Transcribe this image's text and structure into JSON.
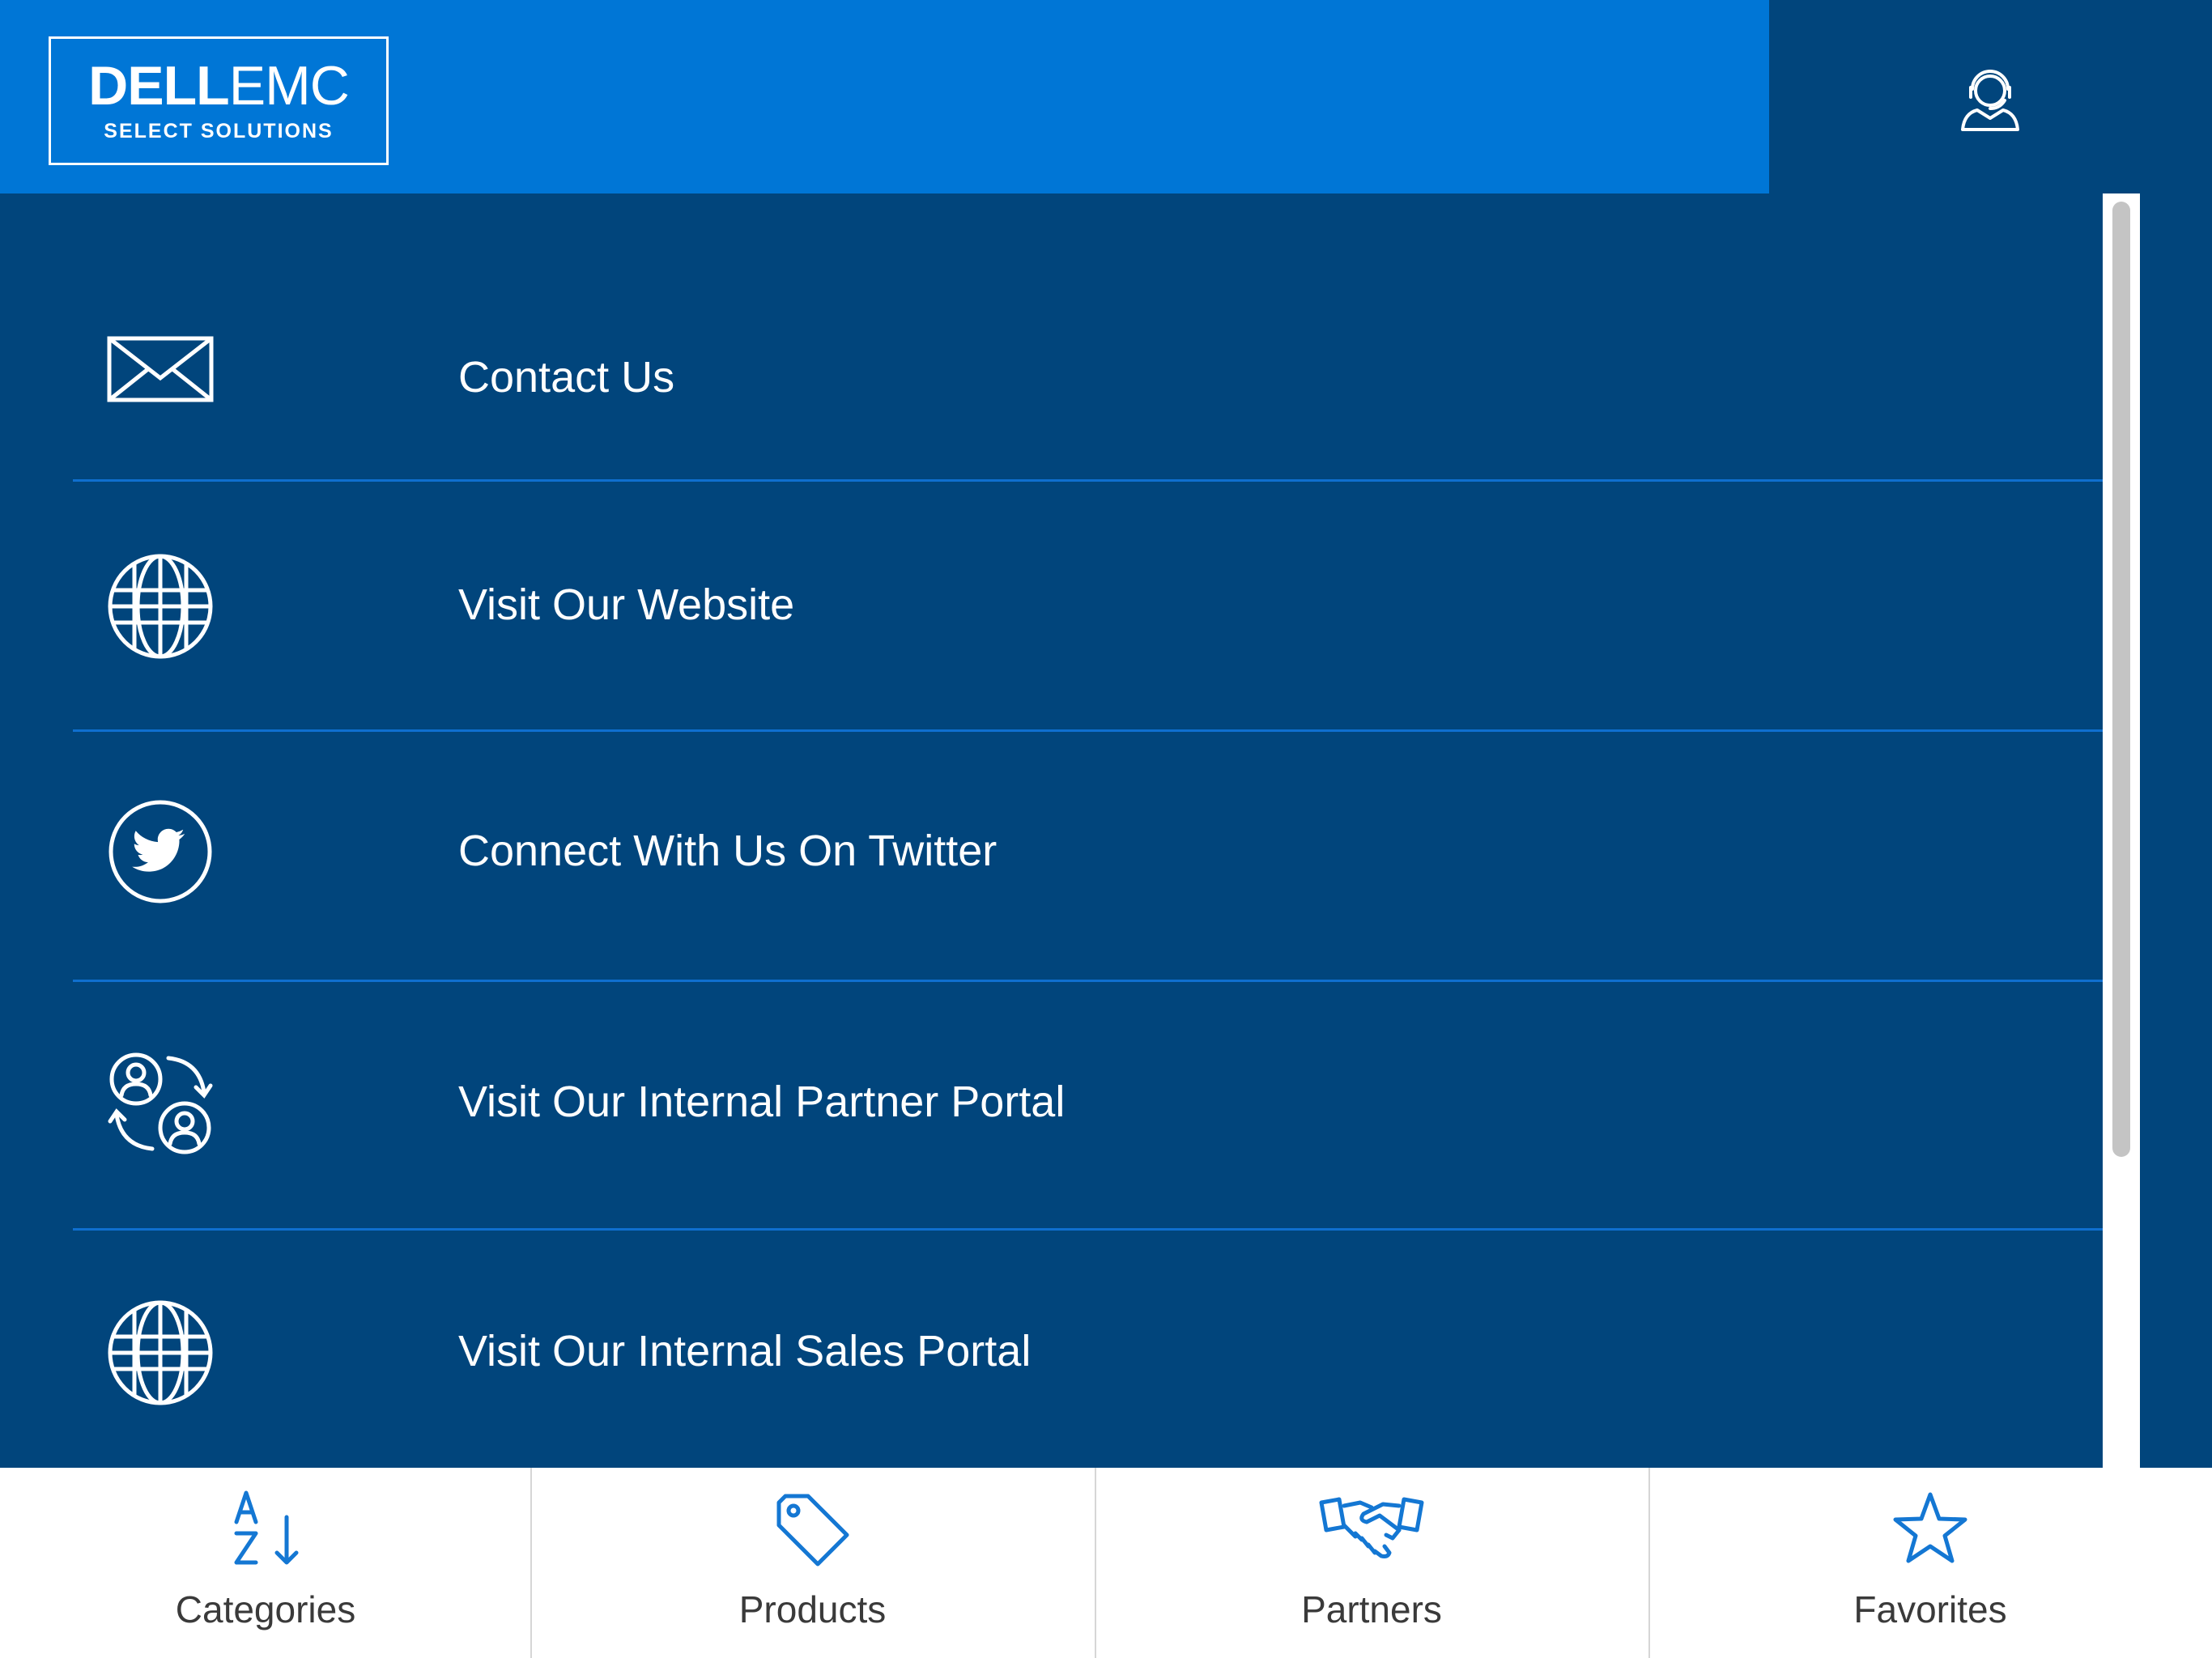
{
  "header": {
    "logo": {
      "brand": "DELL",
      "product": "EMC",
      "subtitle": "SELECT SOLUTIONS"
    },
    "support_icon": "headset-support-icon"
  },
  "menu": {
    "items": [
      {
        "label": "Contact Us",
        "icon": "envelope-icon"
      },
      {
        "label": "Visit Our Website",
        "icon": "globe-icon"
      },
      {
        "label": "Connect With Us On Twitter",
        "icon": "twitter-icon"
      },
      {
        "label": "Visit Our Internal Partner Portal",
        "icon": "partner-exchange-icon"
      },
      {
        "label": "Visit Our Internal Sales Portal",
        "icon": "globe-icon"
      }
    ]
  },
  "tabs": [
    {
      "label": "Categories",
      "icon": "sort-az-icon"
    },
    {
      "label": "Products",
      "icon": "tag-icon"
    },
    {
      "label": "Partners",
      "icon": "handshake-icon"
    },
    {
      "label": "Favorites",
      "icon": "star-icon"
    }
  ],
  "colors": {
    "header_blue": "#0076d6",
    "navy": "#01457c",
    "divider": "#0f6fcf",
    "tab_icon": "#1477d3",
    "tab_text": "#3a3a3a"
  }
}
